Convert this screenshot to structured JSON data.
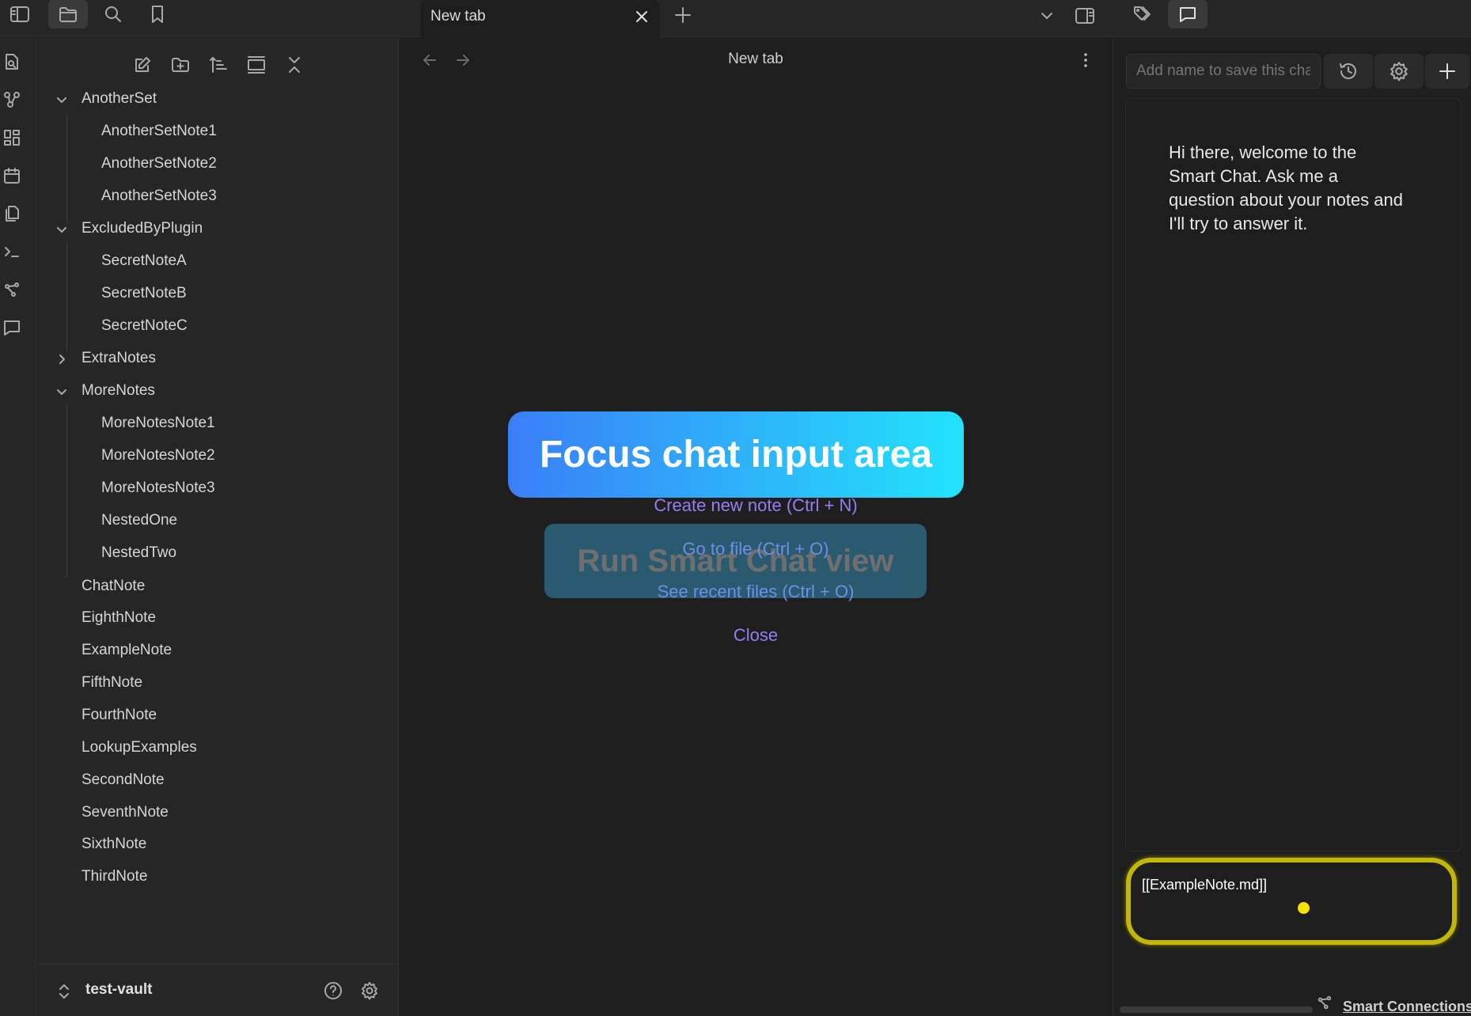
{
  "tab": {
    "title": "New tab"
  },
  "explorer": {
    "items": [
      {
        "label": "AnotherSet",
        "type": "folder",
        "expanded": true,
        "indent": 0
      },
      {
        "label": "AnotherSetNote1",
        "type": "file",
        "indent": 1
      },
      {
        "label": "AnotherSetNote2",
        "type": "file",
        "indent": 1
      },
      {
        "label": "AnotherSetNote3",
        "type": "file",
        "indent": 1
      },
      {
        "label": "ExcludedByPlugin",
        "type": "folder",
        "expanded": true,
        "indent": 0
      },
      {
        "label": "SecretNoteA",
        "type": "file",
        "indent": 1
      },
      {
        "label": "SecretNoteB",
        "type": "file",
        "indent": 1
      },
      {
        "label": "SecretNoteC",
        "type": "file",
        "indent": 1
      },
      {
        "label": "ExtraNotes",
        "type": "folder",
        "expanded": false,
        "indent": 0
      },
      {
        "label": "MoreNotes",
        "type": "folder",
        "expanded": true,
        "indent": 0
      },
      {
        "label": "MoreNotesNote1",
        "type": "file",
        "indent": 1
      },
      {
        "label": "MoreNotesNote2",
        "type": "file",
        "indent": 1
      },
      {
        "label": "MoreNotesNote3",
        "type": "file",
        "indent": 1
      },
      {
        "label": "NestedOne",
        "type": "file",
        "indent": 1
      },
      {
        "label": "NestedTwo",
        "type": "file",
        "indent": 1
      },
      {
        "label": "ChatNote",
        "type": "file",
        "indent": 0
      },
      {
        "label": "EighthNote",
        "type": "file",
        "indent": 0
      },
      {
        "label": "ExampleNote",
        "type": "file",
        "indent": 0
      },
      {
        "label": "FifthNote",
        "type": "file",
        "indent": 0
      },
      {
        "label": "FourthNote",
        "type": "file",
        "indent": 0
      },
      {
        "label": "LookupExamples",
        "type": "file",
        "indent": 0
      },
      {
        "label": "SecondNote",
        "type": "file",
        "indent": 0
      },
      {
        "label": "SeventhNote",
        "type": "file",
        "indent": 0
      },
      {
        "label": "SixthNote",
        "type": "file",
        "indent": 0
      },
      {
        "label": "ThirdNote",
        "type": "file",
        "indent": 0
      }
    ],
    "vault_name": "test-vault"
  },
  "main": {
    "title": "New tab",
    "actions": {
      "create": "Create new note (Ctrl + N)",
      "goto": "Go to file (Ctrl + O)",
      "recent": "See recent files (Ctrl + O)",
      "close": "Close"
    },
    "overlay": {
      "focus_label": "Focus chat input area",
      "run_label": "Run Smart Chat view"
    }
  },
  "chat": {
    "name_placeholder": "Add name to save this chat",
    "welcome": "Hi there, welcome to the Smart Chat. Ask me a question about your notes and I'll try to answer it.",
    "input_value": "[[ExampleNote.md]]",
    "footer_link": "Smart Connections"
  },
  "colors": {
    "accent": "#9a7cf2",
    "highlight": "#c2b60a",
    "gradient_start": "#3a7ef7",
    "gradient_end": "#22e3fb"
  }
}
